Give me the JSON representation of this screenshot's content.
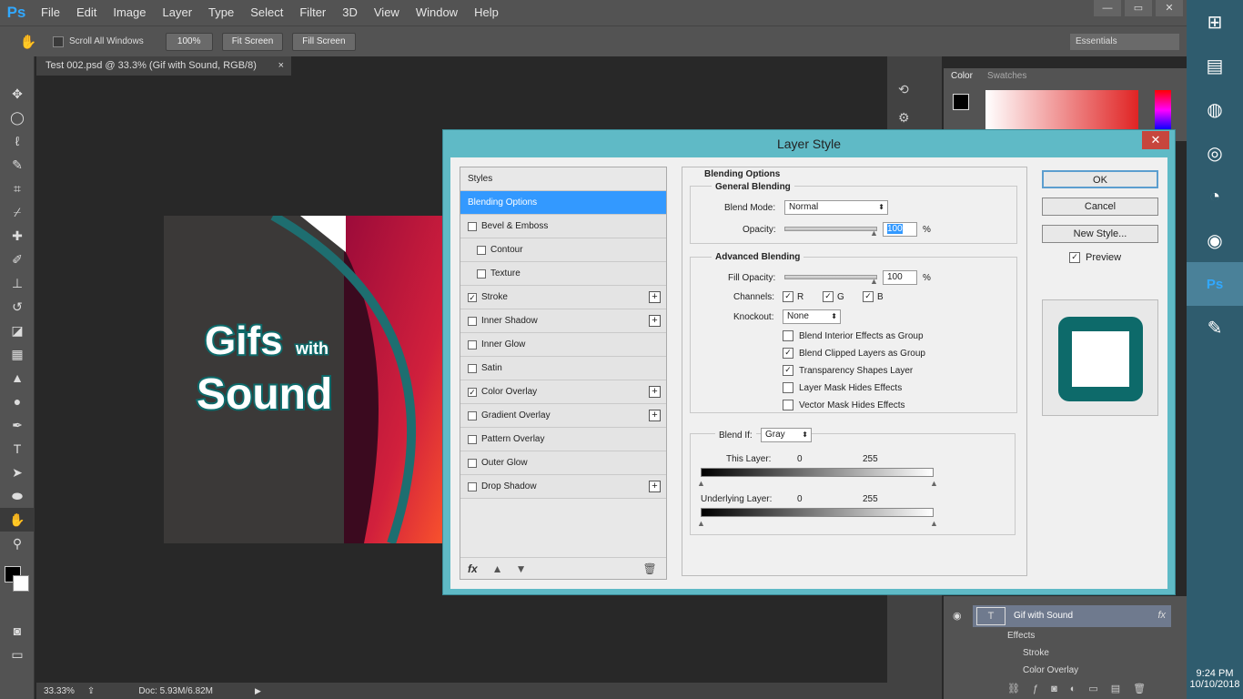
{
  "menubar": {
    "logo": "Ps",
    "items": [
      "File",
      "Edit",
      "Image",
      "Layer",
      "Type",
      "Select",
      "Filter",
      "3D",
      "View",
      "Window",
      "Help"
    ],
    "win_min": "—",
    "win_max": "▭",
    "win_close": "✕"
  },
  "optbar": {
    "scroll_all": "Scroll All Windows",
    "zoom_btn": "100%",
    "fit_btn": "Fit Screen",
    "fill_btn": "Fill Screen",
    "workspace": "Essentials"
  },
  "document": {
    "tab_title": "Test 002.psd @ 33.3% (Gif with Sound, RGB/8)",
    "tab_close": "×",
    "canvas_text_1": "Gifs",
    "canvas_text_2": "with",
    "canvas_text_3": "Sound",
    "status_zoom": "33.33%",
    "status_doc": "Doc: 5.93M/6.82M"
  },
  "color_panel": {
    "tab_color": "Color",
    "tab_swatches": "Swatches"
  },
  "layers_panel": {
    "layer_name": "Gif with Sound",
    "effects_label": "Effects",
    "effect_1": "Stroke",
    "effect_2": "Color Overlay",
    "fx": "fx"
  },
  "dialog": {
    "title": "Layer Style",
    "close": "✕",
    "styles": [
      {
        "label": "Styles",
        "type": "header"
      },
      {
        "label": "Blending Options",
        "type": "selected"
      },
      {
        "label": "Bevel & Emboss",
        "checked": false,
        "plus": false
      },
      {
        "label": "Contour",
        "checked": false,
        "plus": false,
        "indent": true
      },
      {
        "label": "Texture",
        "checked": false,
        "plus": false,
        "indent": true
      },
      {
        "label": "Stroke",
        "checked": true,
        "plus": true
      },
      {
        "label": "Inner Shadow",
        "checked": false,
        "plus": true
      },
      {
        "label": "Inner Glow",
        "checked": false,
        "plus": false
      },
      {
        "label": "Satin",
        "checked": false,
        "plus": false
      },
      {
        "label": "Color Overlay",
        "checked": true,
        "plus": true
      },
      {
        "label": "Gradient Overlay",
        "checked": false,
        "plus": true
      },
      {
        "label": "Pattern Overlay",
        "checked": false,
        "plus": false
      },
      {
        "label": "Outer Glow",
        "checked": false,
        "plus": false
      },
      {
        "label": "Drop Shadow",
        "checked": false,
        "plus": true
      }
    ],
    "fx_label": "fx",
    "blending_options": "Blending Options",
    "general_blending": "General Blending",
    "blend_mode_label": "Blend Mode:",
    "blend_mode_value": "Normal",
    "opacity_label": "Opacity:",
    "opacity_value": "100",
    "percent": "%",
    "advanced_blending": "Advanced Blending",
    "fill_opacity_label": "Fill Opacity:",
    "fill_opacity_value": "100",
    "channels_label": "Channels:",
    "channel_r": "R",
    "channel_g": "G",
    "channel_b": "B",
    "knockout_label": "Knockout:",
    "knockout_value": "None",
    "options": [
      {
        "label": "Blend Interior Effects as Group",
        "checked": false
      },
      {
        "label": "Blend Clipped Layers as Group",
        "checked": true
      },
      {
        "label": "Transparency Shapes Layer",
        "checked": true
      },
      {
        "label": "Layer Mask Hides Effects",
        "checked": false
      },
      {
        "label": "Vector Mask Hides Effects",
        "checked": false
      }
    ],
    "blend_if_label": "Blend If:",
    "blend_if_value": "Gray",
    "this_layer_label": "This Layer:",
    "underlying_label": "Underlying Layer:",
    "range_min": "0",
    "range_max": "255",
    "ok": "OK",
    "cancel": "Cancel",
    "new_style": "New Style...",
    "preview_label": "Preview"
  },
  "taskbar": {
    "time": "9:24 PM",
    "date": "10/10/2018"
  }
}
